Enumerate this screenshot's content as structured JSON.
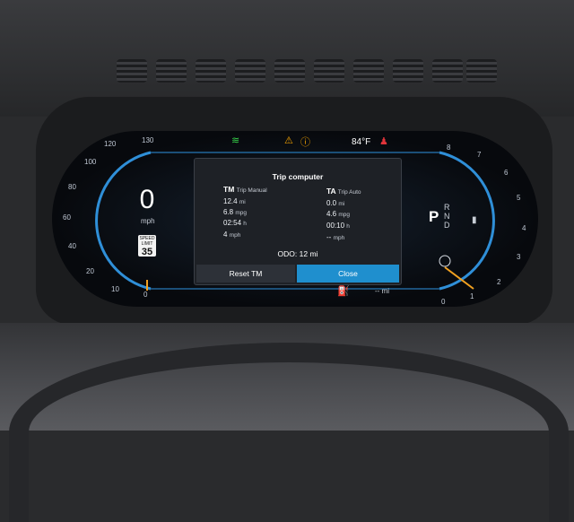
{
  "cluster": {
    "temperature": "84°F",
    "speed": "0",
    "speed_unit": "mph",
    "speed_limit_label": "SPEED LIMIT",
    "speed_limit": "35",
    "speedo_ticks": [
      "20",
      "40",
      "60",
      "80",
      "100",
      "120",
      "130",
      "10",
      "0"
    ],
    "tach_ticks": [
      "8",
      "7",
      "6",
      "5",
      "4",
      "3",
      "2",
      "1",
      "0"
    ],
    "gear": "P",
    "gear_list": [
      "R",
      "N",
      "D"
    ],
    "bottom_range": "-- mi"
  },
  "trip_computer": {
    "title": "Trip computer",
    "tm": {
      "code": "TM",
      "name": "Trip Manual",
      "distance": "12.4",
      "distance_unit": "mi",
      "economy": "6.8",
      "economy_unit": "mpg",
      "time": "02:54",
      "time_unit": "h",
      "avg_speed": "4",
      "avg_speed_unit": "mph"
    },
    "ta": {
      "code": "TA",
      "name": "Trip Auto",
      "distance": "0.0",
      "distance_unit": "mi",
      "economy": "4.6",
      "economy_unit": "mpg",
      "time": "00:10",
      "time_unit": "h",
      "avg_speed": "--",
      "avg_speed_unit": "mph"
    },
    "odo_label": "ODO:",
    "odo_value": "12",
    "odo_unit": "mi",
    "reset_label": "Reset TM",
    "close_label": "Close"
  },
  "colors": {
    "accent": "#1f8fce",
    "ring": "#2f8fd8",
    "needle": "#f0a020",
    "warning": "#f5a300",
    "green_indicator": "#36d24a",
    "red_indicator": "#e0343a"
  }
}
